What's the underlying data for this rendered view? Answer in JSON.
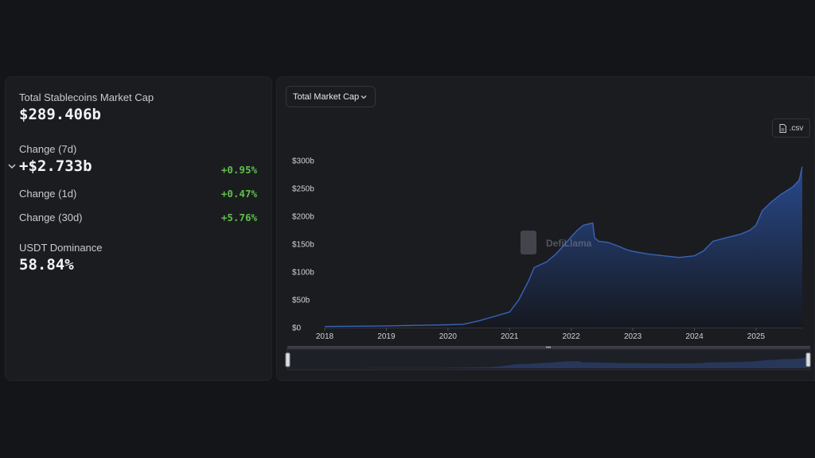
{
  "summary": {
    "total_label": "Total Stablecoins Market Cap",
    "total_value": "$289.406b",
    "change_7d_label": "Change (7d)",
    "change_7d_value": "+$2.733b",
    "change_7d_pct": "+0.95%",
    "change_1d_label": "Change (1d)",
    "change_1d_pct": "+0.47%",
    "change_30d_label": "Change (30d)",
    "change_30d_pct": "+5.76%",
    "dominance_label": "USDT Dominance",
    "dominance_value": "58.84%"
  },
  "toolbar": {
    "metric_select": "Total Market Cap",
    "csv_label": ".csv"
  },
  "watermark": "DefiLlama",
  "colors": {
    "positive": "#5fbf4a",
    "line": "#3a63b8",
    "fill_top": "#2a4c92",
    "fill_bottom": "#15181f"
  },
  "chart_data": {
    "type": "area",
    "ylim": [
      0,
      300
    ],
    "y_ticks": [
      "$0",
      "$50b",
      "$100b",
      "$150b",
      "$200b",
      "$250b",
      "$300b"
    ],
    "x_ticks": [
      "2018",
      "2019",
      "2020",
      "2021",
      "2022",
      "2023",
      "2024",
      "2025"
    ],
    "x_range": [
      2018.0,
      2025.75
    ],
    "series": [
      {
        "x": [
          2018.0,
          2018.5,
          2019.0,
          2019.5,
          2020.0,
          2020.25,
          2020.5,
          2020.75,
          2021.0,
          2021.15,
          2021.3,
          2021.4,
          2021.5,
          2021.6,
          2021.75,
          2021.9,
          2022.0,
          2022.1,
          2022.2,
          2022.35,
          2022.38,
          2022.45,
          2022.6,
          2022.75,
          2022.9,
          2023.0,
          2023.25,
          2023.5,
          2023.75,
          2024.0,
          2024.15,
          2024.3,
          2024.5,
          2024.75,
          2024.9,
          2025.0,
          2025.1,
          2025.25,
          2025.4,
          2025.5,
          2025.6,
          2025.7,
          2025.75
        ],
        "y": [
          2,
          2.5,
          3,
          4,
          5,
          6,
          12,
          20,
          28,
          50,
          82,
          108,
          113,
          118,
          132,
          150,
          163,
          175,
          184,
          188,
          161,
          155,
          153,
          147,
          140,
          137,
          132,
          129,
          126,
          129,
          138,
          155,
          161,
          168,
          175,
          184,
          210,
          226,
          239,
          246,
          253,
          265,
          289
        ]
      }
    ]
  }
}
